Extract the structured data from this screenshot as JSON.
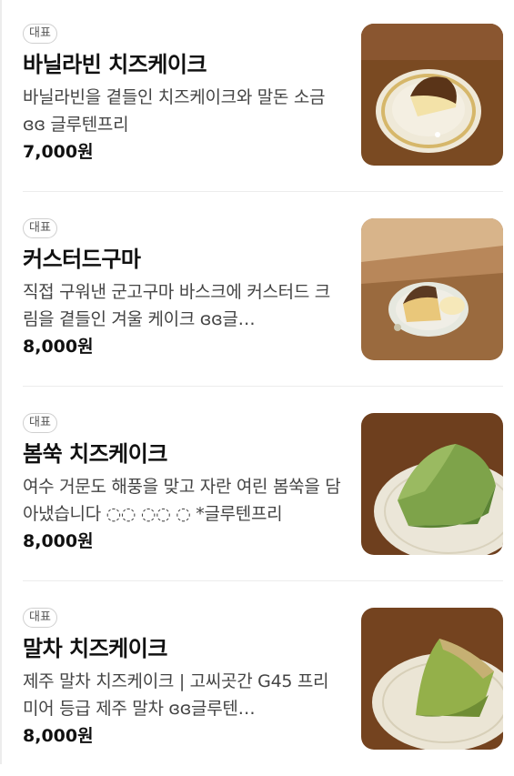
{
  "menu": {
    "items": [
      {
        "badge": "대표",
        "name": "바닐라빈 치즈케이크",
        "description": "바닐라빈을 곁들인 치즈케이크와 말돈 소금 ɞɞ 글루텐프리",
        "price": "7,000원",
        "image": "basque-cheesecake-vanilla-plate-photo"
      },
      {
        "badge": "대표",
        "name": "커스터드구마",
        "description": "직접 구워낸 군고구마 바스크에 커스터드 크림을 곁들인 겨울 케이크 ɞɞ글…",
        "price": "8,000원",
        "image": "sweet-potato-custard-cake-photo"
      },
      {
        "badge": "대표",
        "name": "봄쑥 치즈케이크",
        "description": "여수 거문도 해풍을 맞고 자란 여린 봄쑥을 담아냈습니다 ◌◌ ◌◌ ◌ *글루텐프리",
        "price": "8,000원",
        "image": "mugwort-cheesecake-photo"
      },
      {
        "badge": "대표",
        "name": "말차 치즈케이크",
        "description": "제주 말차 치즈케이크 | 고씨곳간 G45 프리미어 등급 제주 말차 ɞɞ글루텐…",
        "price": "8,000원",
        "image": "matcha-cheesecake-photo"
      }
    ]
  }
}
